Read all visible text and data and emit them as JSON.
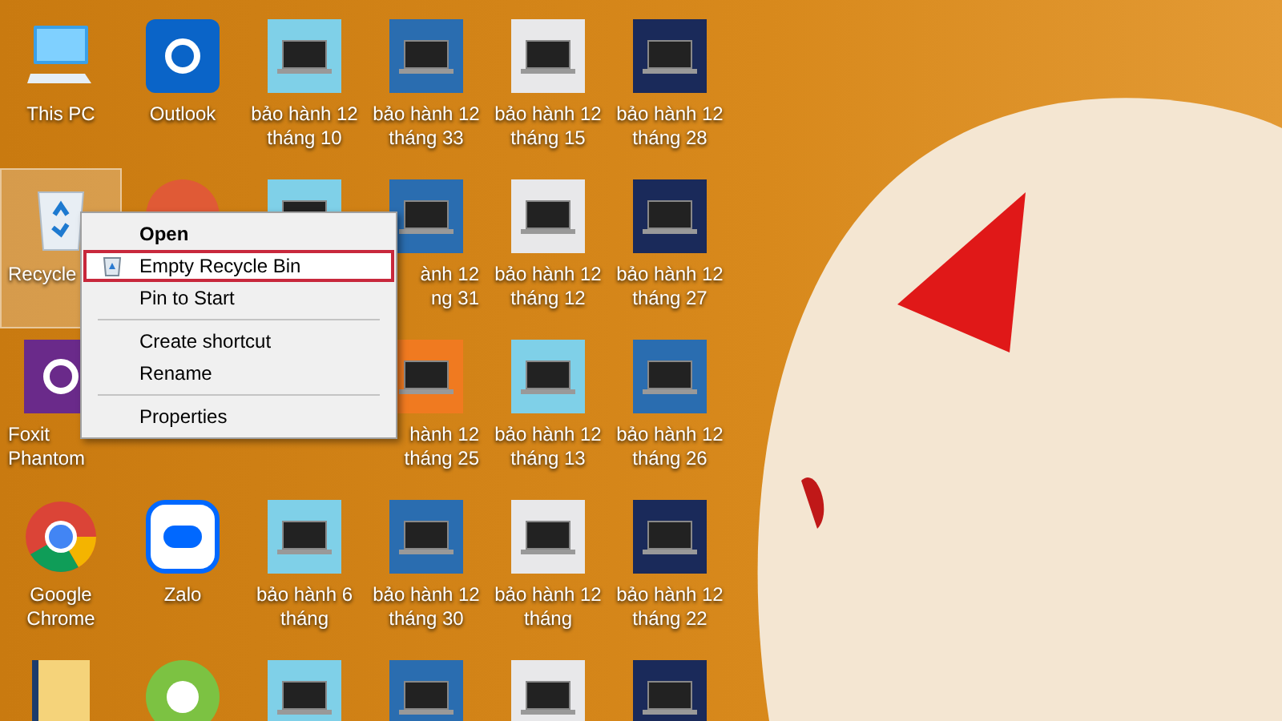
{
  "desktop": {
    "rows": [
      {
        "icons": [
          {
            "kind": "pc",
            "label": [
              "This PC"
            ],
            "selected": false
          },
          {
            "kind": "outlook",
            "label": [
              "Outlook"
            ],
            "selected": false
          },
          {
            "kind": "laptop",
            "label": [
              "bảo hành 12",
              "tháng 10"
            ],
            "selected": false
          },
          {
            "kind": "laptop",
            "label": [
              "bảo hành 12",
              "tháng 33"
            ],
            "selected": false
          },
          {
            "kind": "laptop",
            "label": [
              "bảo hành 12",
              "tháng 15"
            ],
            "selected": false
          },
          {
            "kind": "laptop",
            "label": [
              "bảo hành 12",
              "tháng 28"
            ],
            "selected": false
          }
        ]
      },
      {
        "icons": [
          {
            "kind": "recycle",
            "label": [
              "Recycle"
            ],
            "partly_covered": true,
            "selected": true
          },
          {
            "kind": "powerpoint",
            "selected": false
          },
          {
            "kind": "laptop",
            "selected": false
          },
          {
            "kind": "laptop",
            "label": [
              "ành 12",
              "ng 31"
            ],
            "partly_covered": true,
            "selected": false
          },
          {
            "kind": "laptop",
            "label": [
              "bảo hành 12",
              "tháng 12"
            ],
            "selected": false
          },
          {
            "kind": "laptop",
            "label": [
              "bảo hành 12",
              "tháng 27"
            ],
            "selected": false
          }
        ]
      },
      {
        "icons": [
          {
            "kind": "foxit",
            "label": [
              "Foxit",
              "Phantom"
            ],
            "partly_covered": true,
            "selected": false
          },
          {
            "kind": "laptop",
            "label": [
              "hành 12",
              "tháng 25"
            ],
            "partly_covered": true,
            "selected": false
          },
          {
            "kind": "laptop",
            "label": [
              "bảo hành 12",
              "tháng 13"
            ],
            "selected": false
          },
          {
            "kind": "laptop",
            "label": [
              "bảo hành 12",
              "tháng 26"
            ],
            "selected": false
          }
        ]
      },
      {
        "icons": [
          {
            "kind": "chrome",
            "label": [
              "Google",
              "Chrome"
            ],
            "selected": false
          },
          {
            "kind": "zalo",
            "label": [
              "Zalo"
            ],
            "selected": false
          },
          {
            "kind": "laptop",
            "label": [
              "bảo hành 6",
              "tháng"
            ],
            "selected": false
          },
          {
            "kind": "laptop",
            "label": [
              "bảo hành 12",
              "tháng 30"
            ],
            "selected": false
          },
          {
            "kind": "laptop",
            "label": [
              "bảo hành 12",
              "tháng"
            ],
            "selected": false
          },
          {
            "kind": "laptop",
            "label": [
              "bảo hành 12",
              "tháng 22"
            ],
            "selected": false
          }
        ]
      },
      {
        "icons": [
          {
            "kind": "folder",
            "selected": false
          },
          {
            "kind": "coccoc",
            "selected": false
          },
          {
            "kind": "laptop",
            "selected": false
          },
          {
            "kind": "laptop",
            "selected": false
          },
          {
            "kind": "laptop",
            "selected": false
          },
          {
            "kind": "laptop",
            "selected": false
          }
        ]
      }
    ]
  },
  "context_menu": {
    "items": [
      {
        "kind": "item",
        "label": "Open",
        "bold": true,
        "highlighted": false
      },
      {
        "kind": "icon_item",
        "label": "Empty Recycle Bin",
        "bold": false,
        "highlighted": true
      },
      {
        "kind": "item",
        "label": "Pin to Start",
        "bold": false,
        "highlighted": false
      },
      {
        "kind": "separator"
      },
      {
        "kind": "item",
        "label": "Create shortcut",
        "bold": false,
        "highlighted": false
      },
      {
        "kind": "item",
        "label": "Rename",
        "bold": false,
        "highlighted": false
      },
      {
        "kind": "separator"
      },
      {
        "kind": "item",
        "label": "Properties",
        "bold": false,
        "highlighted": false
      }
    ]
  }
}
